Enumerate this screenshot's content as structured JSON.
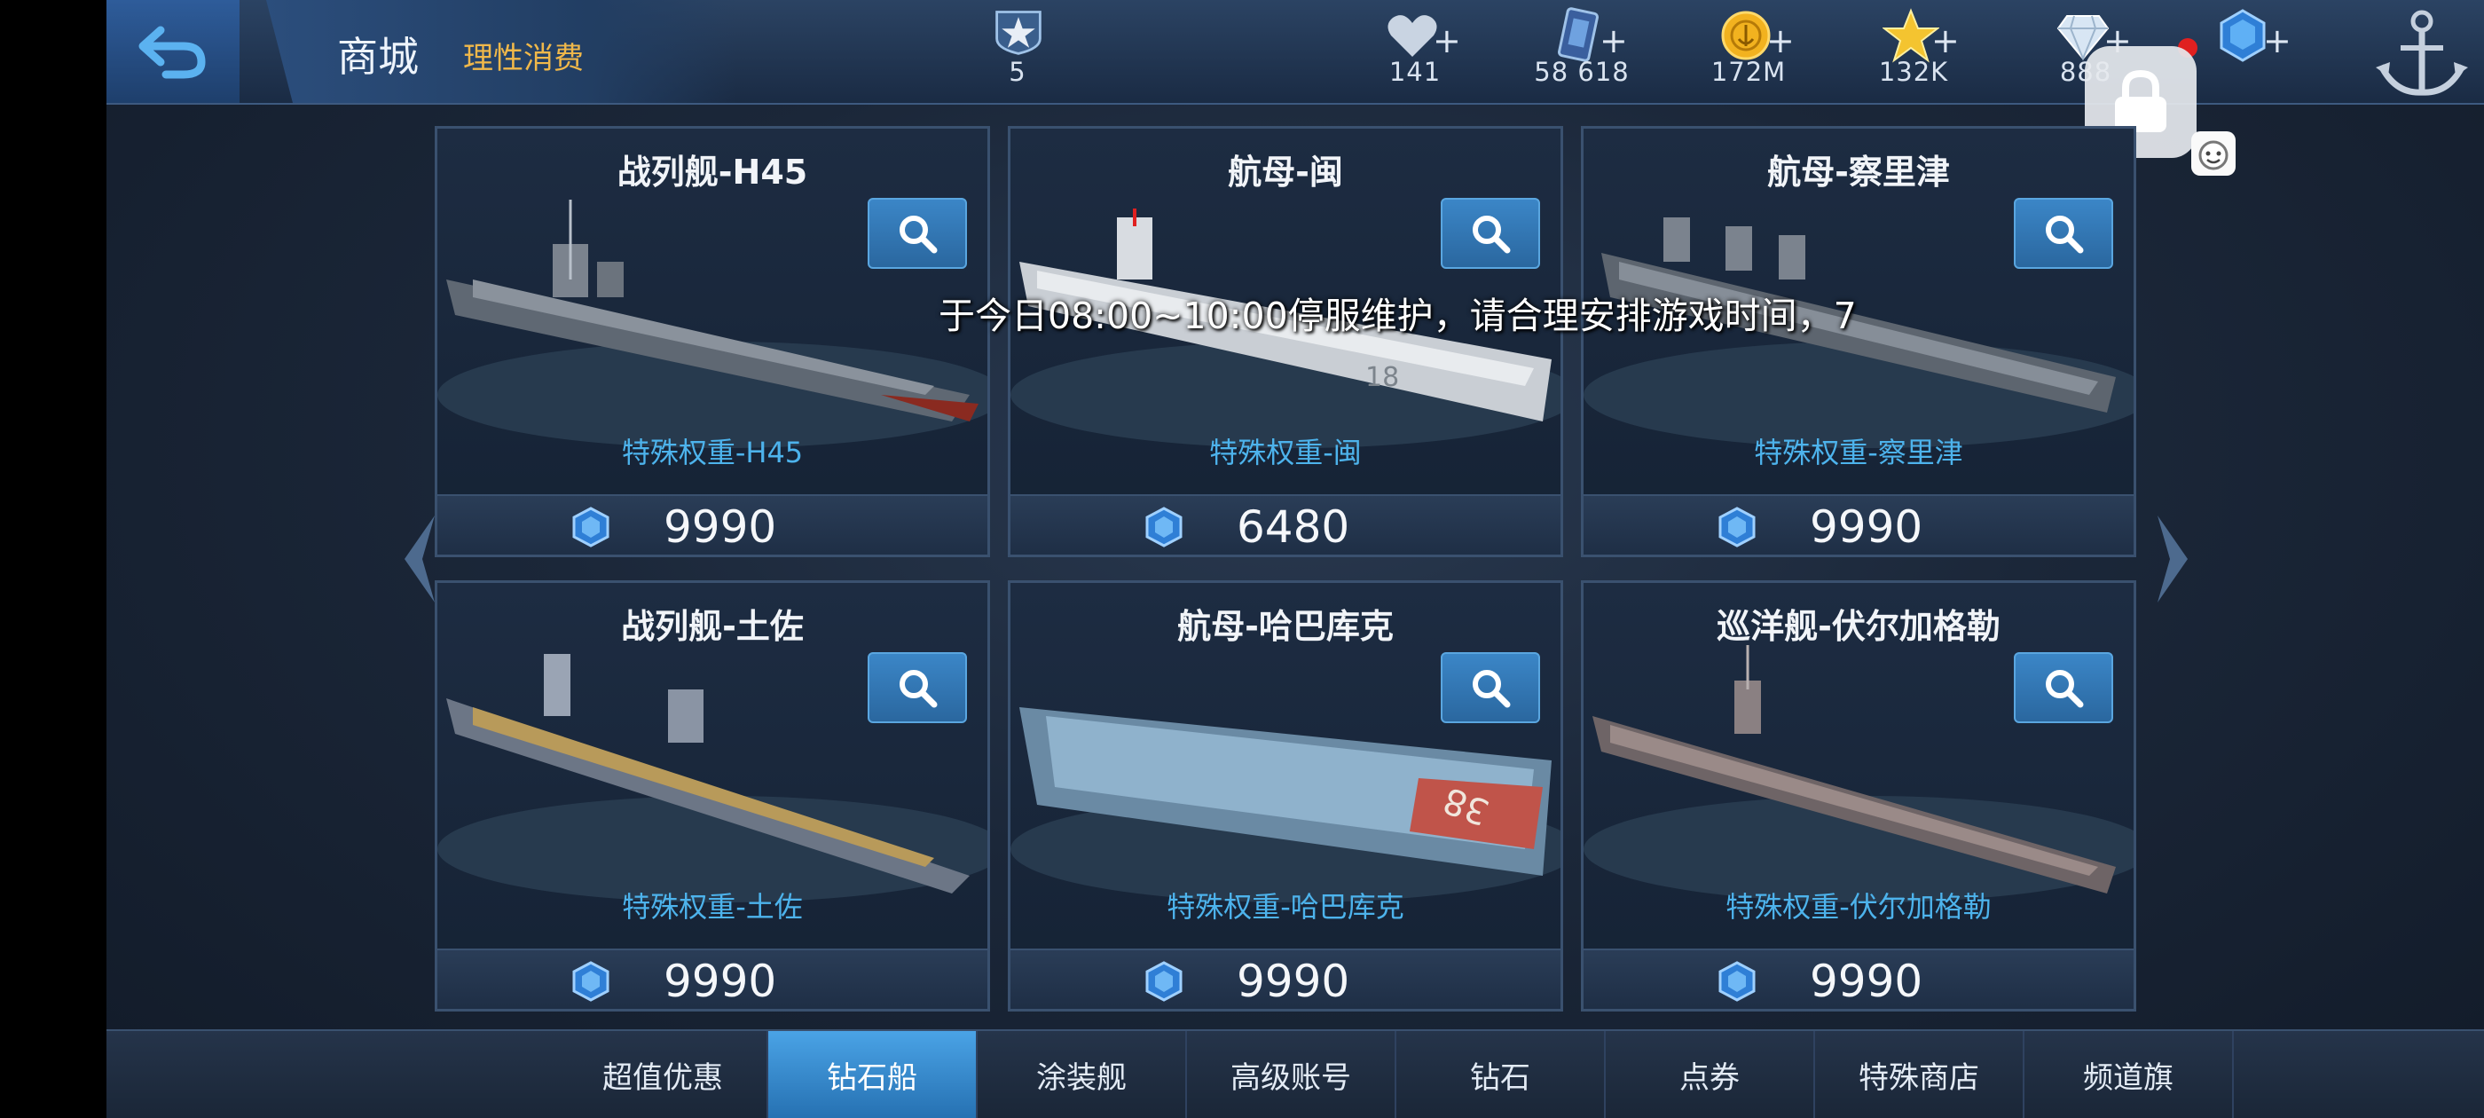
{
  "header": {
    "title": "商城",
    "subtitle": "理性消费",
    "rank_value": "5",
    "resources": [
      {
        "icon": "heart-icon",
        "value": "141"
      },
      {
        "icon": "card-icon",
        "value": "58 618"
      },
      {
        "icon": "gold-coin-icon",
        "value": "172M"
      },
      {
        "icon": "star-icon",
        "value": "132K"
      },
      {
        "icon": "diamond-icon",
        "value": "888"
      },
      {
        "icon": "blue-gem-icon",
        "value": ""
      }
    ]
  },
  "marquee": "于今日08:00~10:00停服维护，请合理安排游戏时间，7",
  "ships": [
    {
      "name": "战列舰-H45",
      "weight": "特殊权重-H45",
      "price": "9990"
    },
    {
      "name": "航母-闽",
      "weight": "特殊权重-闽",
      "price": "6480"
    },
    {
      "name": "航母-察里津",
      "weight": "特殊权重-察里津",
      "price": "9990"
    },
    {
      "name": "战列舰-土佐",
      "weight": "特殊权重-土佐",
      "price": "9990"
    },
    {
      "name": "航母-哈巴库克",
      "weight": "特殊权重-哈巴库克",
      "price": "9990"
    },
    {
      "name": "巡洋舰-伏尔加格勒",
      "weight": "特殊权重-伏尔加格勒",
      "price": "9990"
    }
  ],
  "nav": {
    "tabs": [
      {
        "label": "超值优惠",
        "active": false
      },
      {
        "label": "钻石船",
        "active": true
      },
      {
        "label": "涂装舰",
        "active": false
      },
      {
        "label": "高级账号",
        "active": false
      },
      {
        "label": "钻石",
        "active": false
      },
      {
        "label": "点券",
        "active": false
      },
      {
        "label": "特殊商店",
        "active": false
      },
      {
        "label": "频道旗",
        "active": false
      }
    ]
  },
  "colors": {
    "accent_blue": "#3b86c7",
    "weight_text": "#4db3ec",
    "subtitle_gold": "#f0b84a",
    "alert_red": "#e02020"
  }
}
